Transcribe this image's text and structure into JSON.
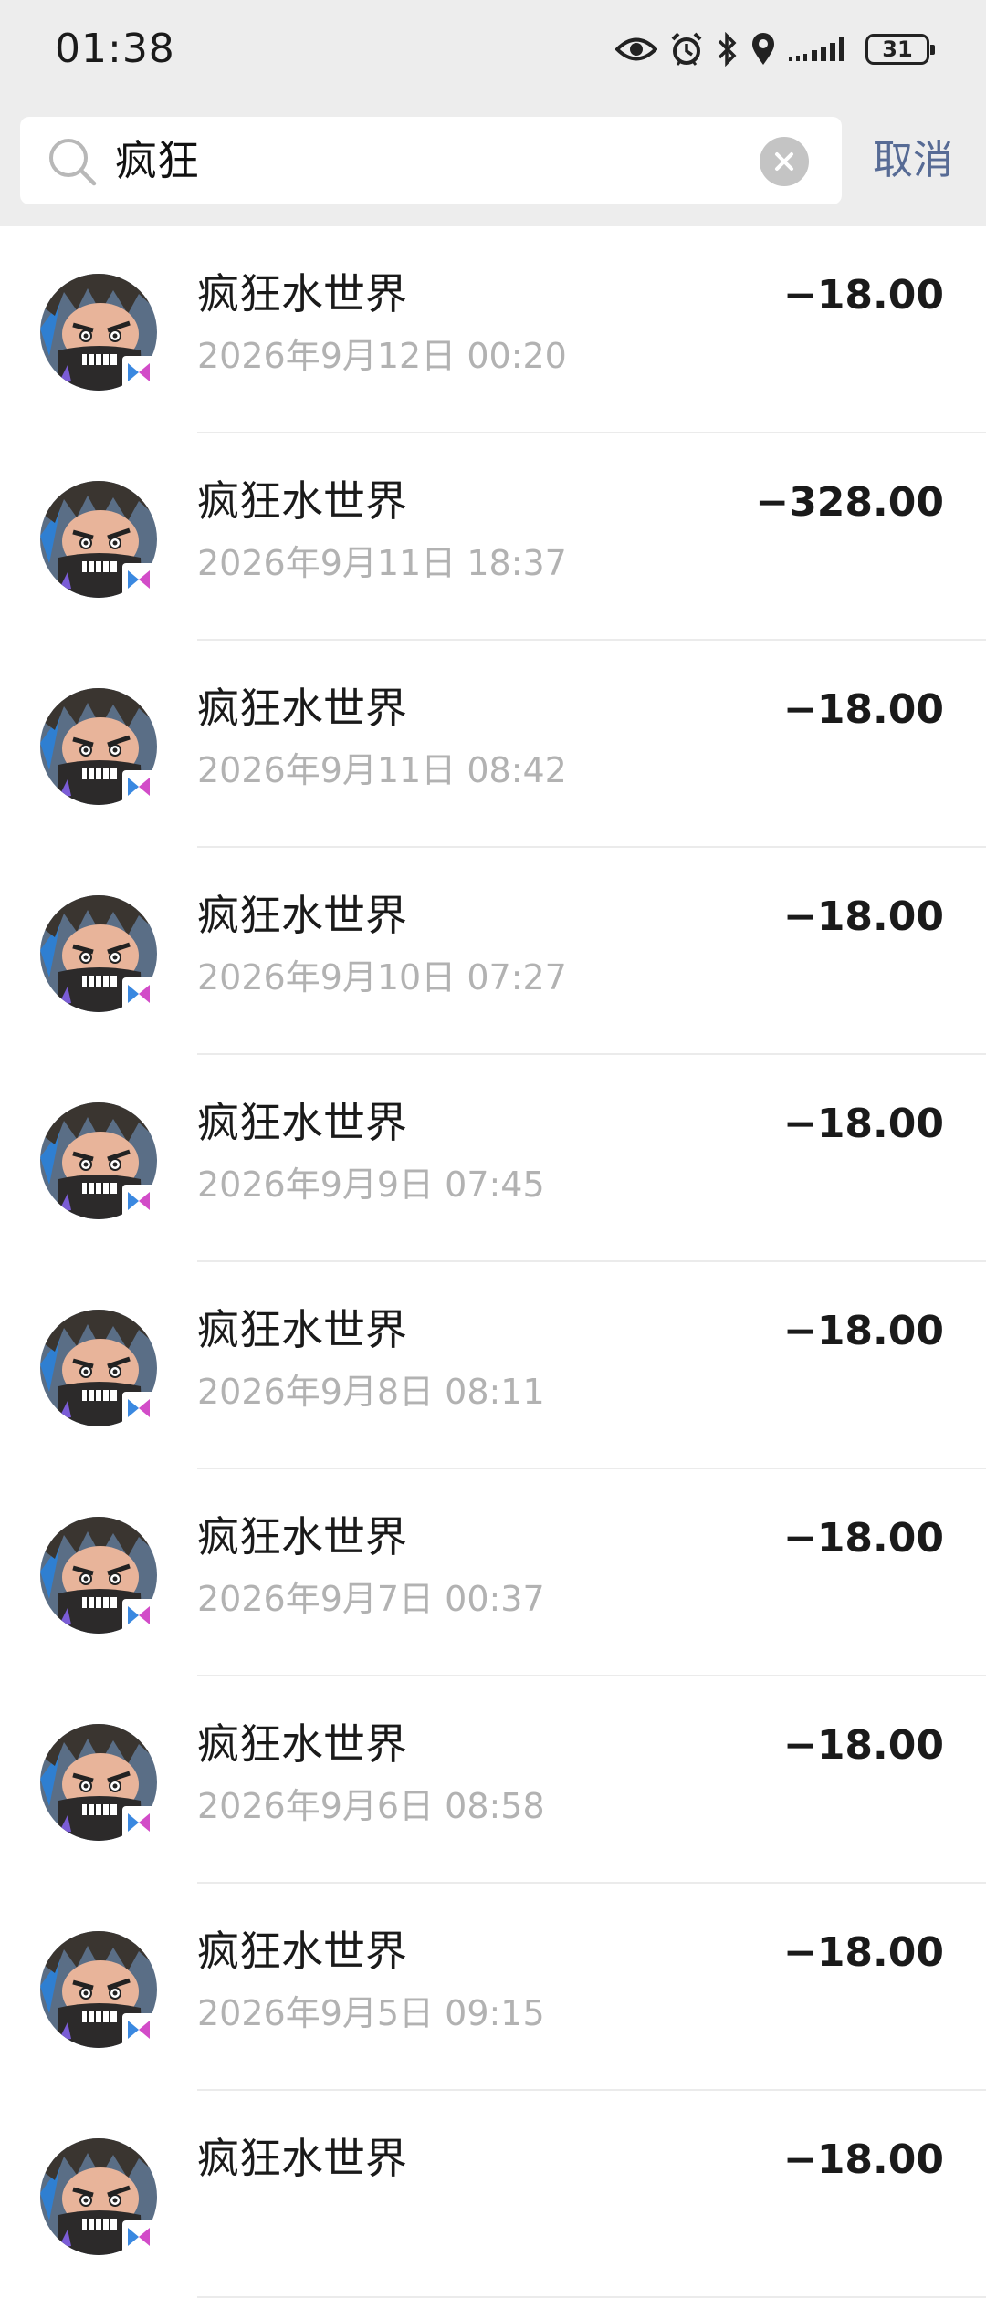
{
  "status_bar": {
    "time": "01:38",
    "battery": "31",
    "icons": [
      "eye-icon",
      "alarm-icon",
      "bluetooth-icon",
      "location-icon",
      "signal-icon",
      "battery-icon"
    ]
  },
  "search": {
    "query": "疯狂",
    "cancel_label": "取消"
  },
  "transactions": [
    {
      "name": "疯狂水世界",
      "date": "2026年9月12日 00:20",
      "amount": "−18.00"
    },
    {
      "name": "疯狂水世界",
      "date": "2026年9月11日 18:37",
      "amount": "−328.00"
    },
    {
      "name": "疯狂水世界",
      "date": "2026年9月11日 08:42",
      "amount": "−18.00"
    },
    {
      "name": "疯狂水世界",
      "date": "2026年9月10日 07:27",
      "amount": "−18.00"
    },
    {
      "name": "疯狂水世界",
      "date": "2026年9月9日 07:45",
      "amount": "−18.00"
    },
    {
      "name": "疯狂水世界",
      "date": "2026年9月8日 08:11",
      "amount": "−18.00"
    },
    {
      "name": "疯狂水世界",
      "date": "2026年9月7日 00:37",
      "amount": "−18.00"
    },
    {
      "name": "疯狂水世界",
      "date": "2026年9月6日 08:58",
      "amount": "−18.00"
    },
    {
      "name": "疯狂水世界",
      "date": "2026年9月5日 09:15",
      "amount": "−18.00"
    },
    {
      "name": "疯狂水世界",
      "date": "",
      "amount": "−18.00"
    }
  ],
  "colors": {
    "link": "#576b95",
    "secondary_text": "#b2b2b2",
    "header_bg": "#ededed"
  }
}
